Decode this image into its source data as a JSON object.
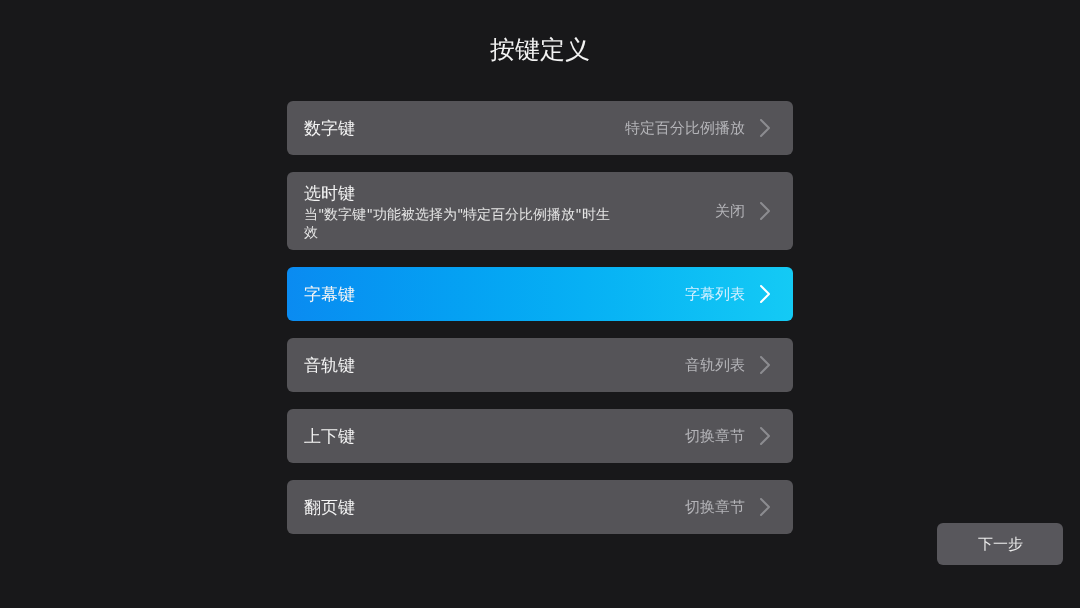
{
  "title": "按键定义",
  "items": [
    {
      "label": "数字键",
      "value": "特定百分比例播放",
      "selected": false
    },
    {
      "label": "选时键",
      "description": "当\"数字键\"功能被选择为\"特定百分比例播放\"时生效",
      "value": "关闭",
      "selected": false
    },
    {
      "label": "字幕键",
      "value": "字幕列表",
      "selected": true
    },
    {
      "label": "音轨键",
      "value": "音轨列表",
      "selected": false
    },
    {
      "label": "上下键",
      "value": "切换章节",
      "selected": false
    },
    {
      "label": "翻页键",
      "value": "切换章节",
      "selected": false
    }
  ],
  "next_button": "下一步"
}
